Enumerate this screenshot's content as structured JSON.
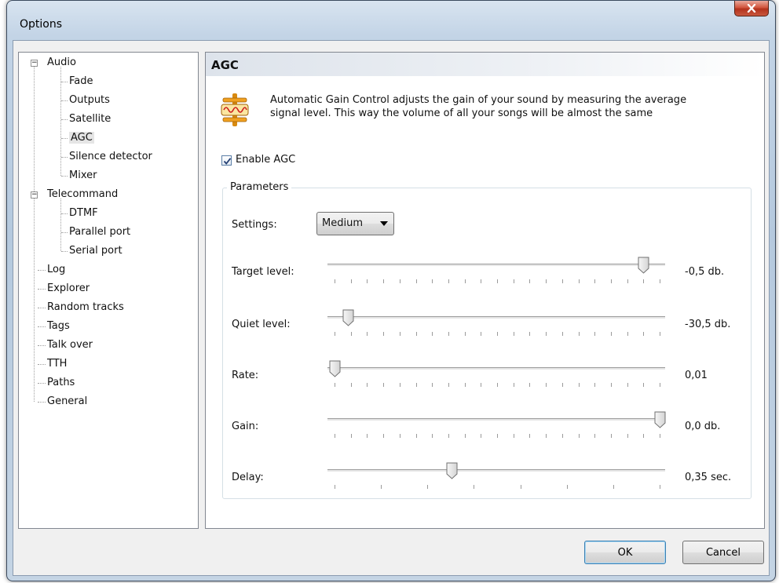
{
  "window": {
    "title": "Options"
  },
  "tree": {
    "items": [
      {
        "label": "Audio",
        "expander": "−"
      },
      {
        "label": "Fade"
      },
      {
        "label": "Outputs"
      },
      {
        "label": "Satellite"
      },
      {
        "label": "AGC",
        "selected": true
      },
      {
        "label": "Silence detector"
      },
      {
        "label": "Mixer"
      },
      {
        "label": "Telecommand",
        "expander": "−"
      },
      {
        "label": "DTMF"
      },
      {
        "label": "Parallel port"
      },
      {
        "label": "Serial port"
      },
      {
        "label": "Log"
      },
      {
        "label": "Explorer"
      },
      {
        "label": "Random tracks"
      },
      {
        "label": "Tags"
      },
      {
        "label": "Talk over"
      },
      {
        "label": "TTH"
      },
      {
        "label": "Paths"
      },
      {
        "label": "General"
      }
    ]
  },
  "panel": {
    "header": "AGC",
    "description_line1": "Automatic Gain Control adjusts the gain of your sound by measuring the average",
    "description_line2": "signal level. This way the volume of all your songs will be almost the same",
    "enable_label": "Enable AGC",
    "enable_checked": true,
    "group_label": "Parameters",
    "settings_label": "Settings:",
    "settings_value": "Medium",
    "sliders": [
      {
        "label": "Target level:",
        "value": "-0,5 db.",
        "position": 0.95
      },
      {
        "label": "Quiet level:",
        "value": "-30,5 db.",
        "position": 0.04
      },
      {
        "label": "Rate:",
        "value": "0,01",
        "position": 0.0
      },
      {
        "label": "Gain:",
        "value": "0,0 db.",
        "position": 1.0
      },
      {
        "label": "Delay:",
        "value": "0,35 sec.",
        "position": 0.36
      }
    ]
  },
  "buttons": {
    "ok": "OK",
    "cancel": "Cancel"
  },
  "colors": {
    "accent": "#3c7fb1",
    "close": "#c9573e",
    "icon_orange": "#f0a020",
    "icon_red": "#cc2020"
  }
}
